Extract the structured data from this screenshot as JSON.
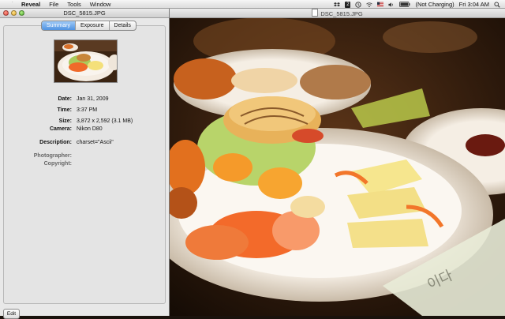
{
  "menubar": {
    "app_name": "Reveal",
    "menus": [
      "File",
      "Tools",
      "Window"
    ],
    "status_icons": [
      "dropbox-icon",
      "badge-icon",
      "time-machine-icon",
      "wifi-icon",
      "flag-icon",
      "volume-icon",
      "battery-icon"
    ],
    "badge_count": "2",
    "battery_status": "(Not Charging)",
    "clock": "Fri 3:04 AM"
  },
  "inspector": {
    "title": "DSC_5815.JPG",
    "tabs": [
      {
        "label": "Summary",
        "active": true
      },
      {
        "label": "Exposure",
        "active": false
      },
      {
        "label": "Details",
        "active": false
      }
    ],
    "rows": {
      "date": {
        "label": "Date:",
        "value": "Jan 31, 2009"
      },
      "time": {
        "label": "Time:",
        "value": "3:37 PM"
      },
      "size": {
        "label": "Size:",
        "value": "3,872 x 2,592 (3.1 MB)"
      },
      "camera": {
        "label": "Camera:",
        "value": "Nikon D80"
      },
      "description": {
        "label": "Description:",
        "value": "charset=\"Ascii\""
      },
      "photographer": {
        "label": "Photographer:",
        "value": ""
      },
      "copyright": {
        "label": "Copyright:",
        "value": ""
      }
    },
    "edit_label": "Edit"
  },
  "image_window": {
    "title": "DSC_5815.JPG"
  }
}
